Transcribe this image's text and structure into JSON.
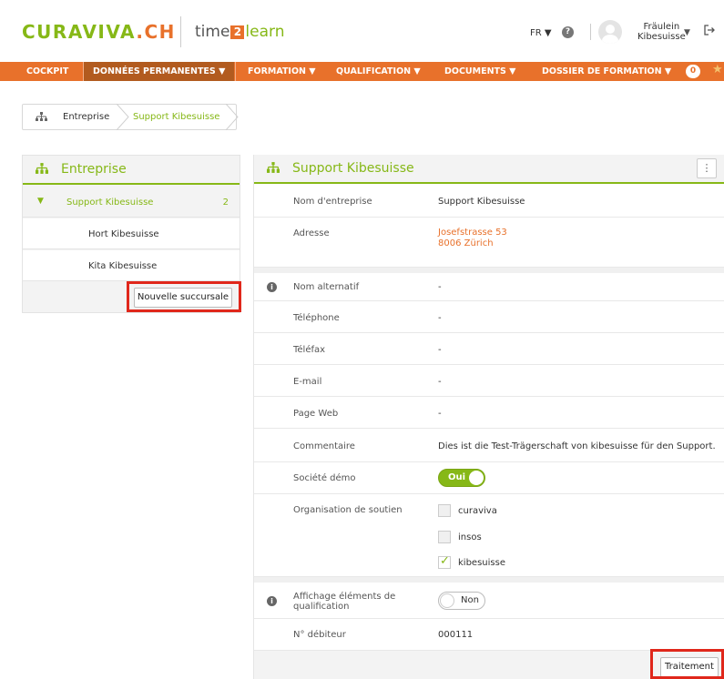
{
  "header": {
    "logo_curaviva": "CURAVIVA",
    "logo_ch": ".CH",
    "logo_time": "time",
    "logo_two": "2",
    "logo_learn": "learn",
    "language": "FR ▼",
    "help": "?",
    "user_line1": "Fräulein",
    "user_line2": "Kibesuisse",
    "user_arrow": "▼",
    "logout_icon": "logout-icon"
  },
  "nav": {
    "items": [
      {
        "label": "COCKPIT"
      },
      {
        "label": "DONNÉES PERMANENTES ▼"
      },
      {
        "label": "FORMATION ▼"
      },
      {
        "label": "QUALIFICATION ▼"
      },
      {
        "label": "DOCUMENTS ▼"
      },
      {
        "label": "DOSSIER DE FORMATION ▼"
      }
    ],
    "badge": "0",
    "accent": "#e8712b",
    "active_color": "#b25b1f"
  },
  "breadcrumb": {
    "items": [
      "Entreprise",
      "Support Kibesuisse"
    ]
  },
  "left_panel": {
    "title": "Entreprise",
    "root": {
      "label": "Support Kibesuisse",
      "count": "2"
    },
    "children": [
      "Hort Kibesuisse",
      "Kita Kibesuisse"
    ],
    "new_branch_button": "Nouvelle succursale"
  },
  "right_panel": {
    "title": "Support Kibesuisse",
    "menu_icon": "⋮",
    "fields": {
      "company_name": {
        "label": "Nom d'entreprise",
        "value": "Support Kibesuisse"
      },
      "address": {
        "label": "Adresse",
        "line1": "Josefstrasse 53",
        "line2": "8006 Zürich"
      },
      "alt_name": {
        "label": "Nom alternatif",
        "value": "-"
      },
      "phone": {
        "label": "Téléphone",
        "value": "-"
      },
      "fax": {
        "label": "Téléfax",
        "value": "-"
      },
      "email": {
        "label": "E-mail",
        "value": "-"
      },
      "web": {
        "label": "Page Web",
        "value": "-"
      },
      "comment": {
        "label": "Commentaire",
        "value": "Dies ist die Test-Trägerschaft von kibesuisse für den Support."
      },
      "demo": {
        "label": "Société démo",
        "value": "Oui"
      },
      "support_org": {
        "label": "Organisation de soutien",
        "options": [
          {
            "label": "curaviva",
            "checked": false
          },
          {
            "label": "insos",
            "checked": false
          },
          {
            "label": "kibesuisse",
            "checked": true
          }
        ]
      },
      "qualif_display": {
        "label_line1": "Affichage éléments de",
        "label_line2": "qualification",
        "value": "Non"
      },
      "debtor": {
        "label": "N° débiteur",
        "value": "000111"
      }
    },
    "process_button": "Traitement"
  },
  "colors": {
    "green": "#86b817",
    "orange": "#e8712b",
    "highlight": "#e0271b"
  }
}
